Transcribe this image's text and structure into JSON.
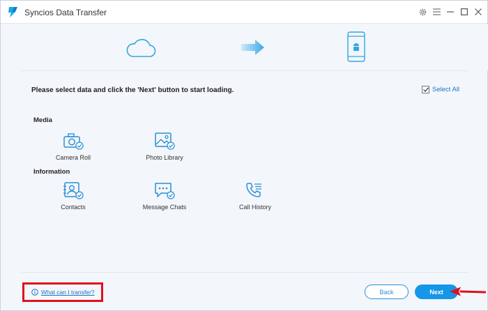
{
  "window": {
    "title": "Syncios Data Transfer"
  },
  "titlebar": {
    "icons": [
      "gear-icon",
      "menu-icon",
      "minimize-icon",
      "maximize-icon",
      "close-icon"
    ]
  },
  "banner": {
    "source_icon": "cloud-icon",
    "direction_icon": "arrow-right-icon",
    "target_icon": "android-phone-icon"
  },
  "main": {
    "instruction": "Please select data and click the 'Next' button to start loading.",
    "select_all_label": "Select All",
    "select_all_checked": true,
    "sections": [
      {
        "title": "Media",
        "items": [
          {
            "label": "Camera Roll",
            "icon": "camera-icon"
          },
          {
            "label": "Photo Library",
            "icon": "photo-icon"
          }
        ]
      },
      {
        "title": "Information",
        "items": [
          {
            "label": "Contacts",
            "icon": "contacts-icon"
          },
          {
            "label": "Message Chats",
            "icon": "message-icon"
          },
          {
            "label": "Call History",
            "icon": "call-history-icon"
          }
        ]
      }
    ]
  },
  "footer": {
    "help_link": "What can I transfer?",
    "back_label": "Back",
    "next_label": "Next"
  },
  "colors": {
    "accent": "#1596e8",
    "icon_blue": "#2a8fd8",
    "annotation_red": "#e0101b",
    "background": "#f3f6fa"
  }
}
